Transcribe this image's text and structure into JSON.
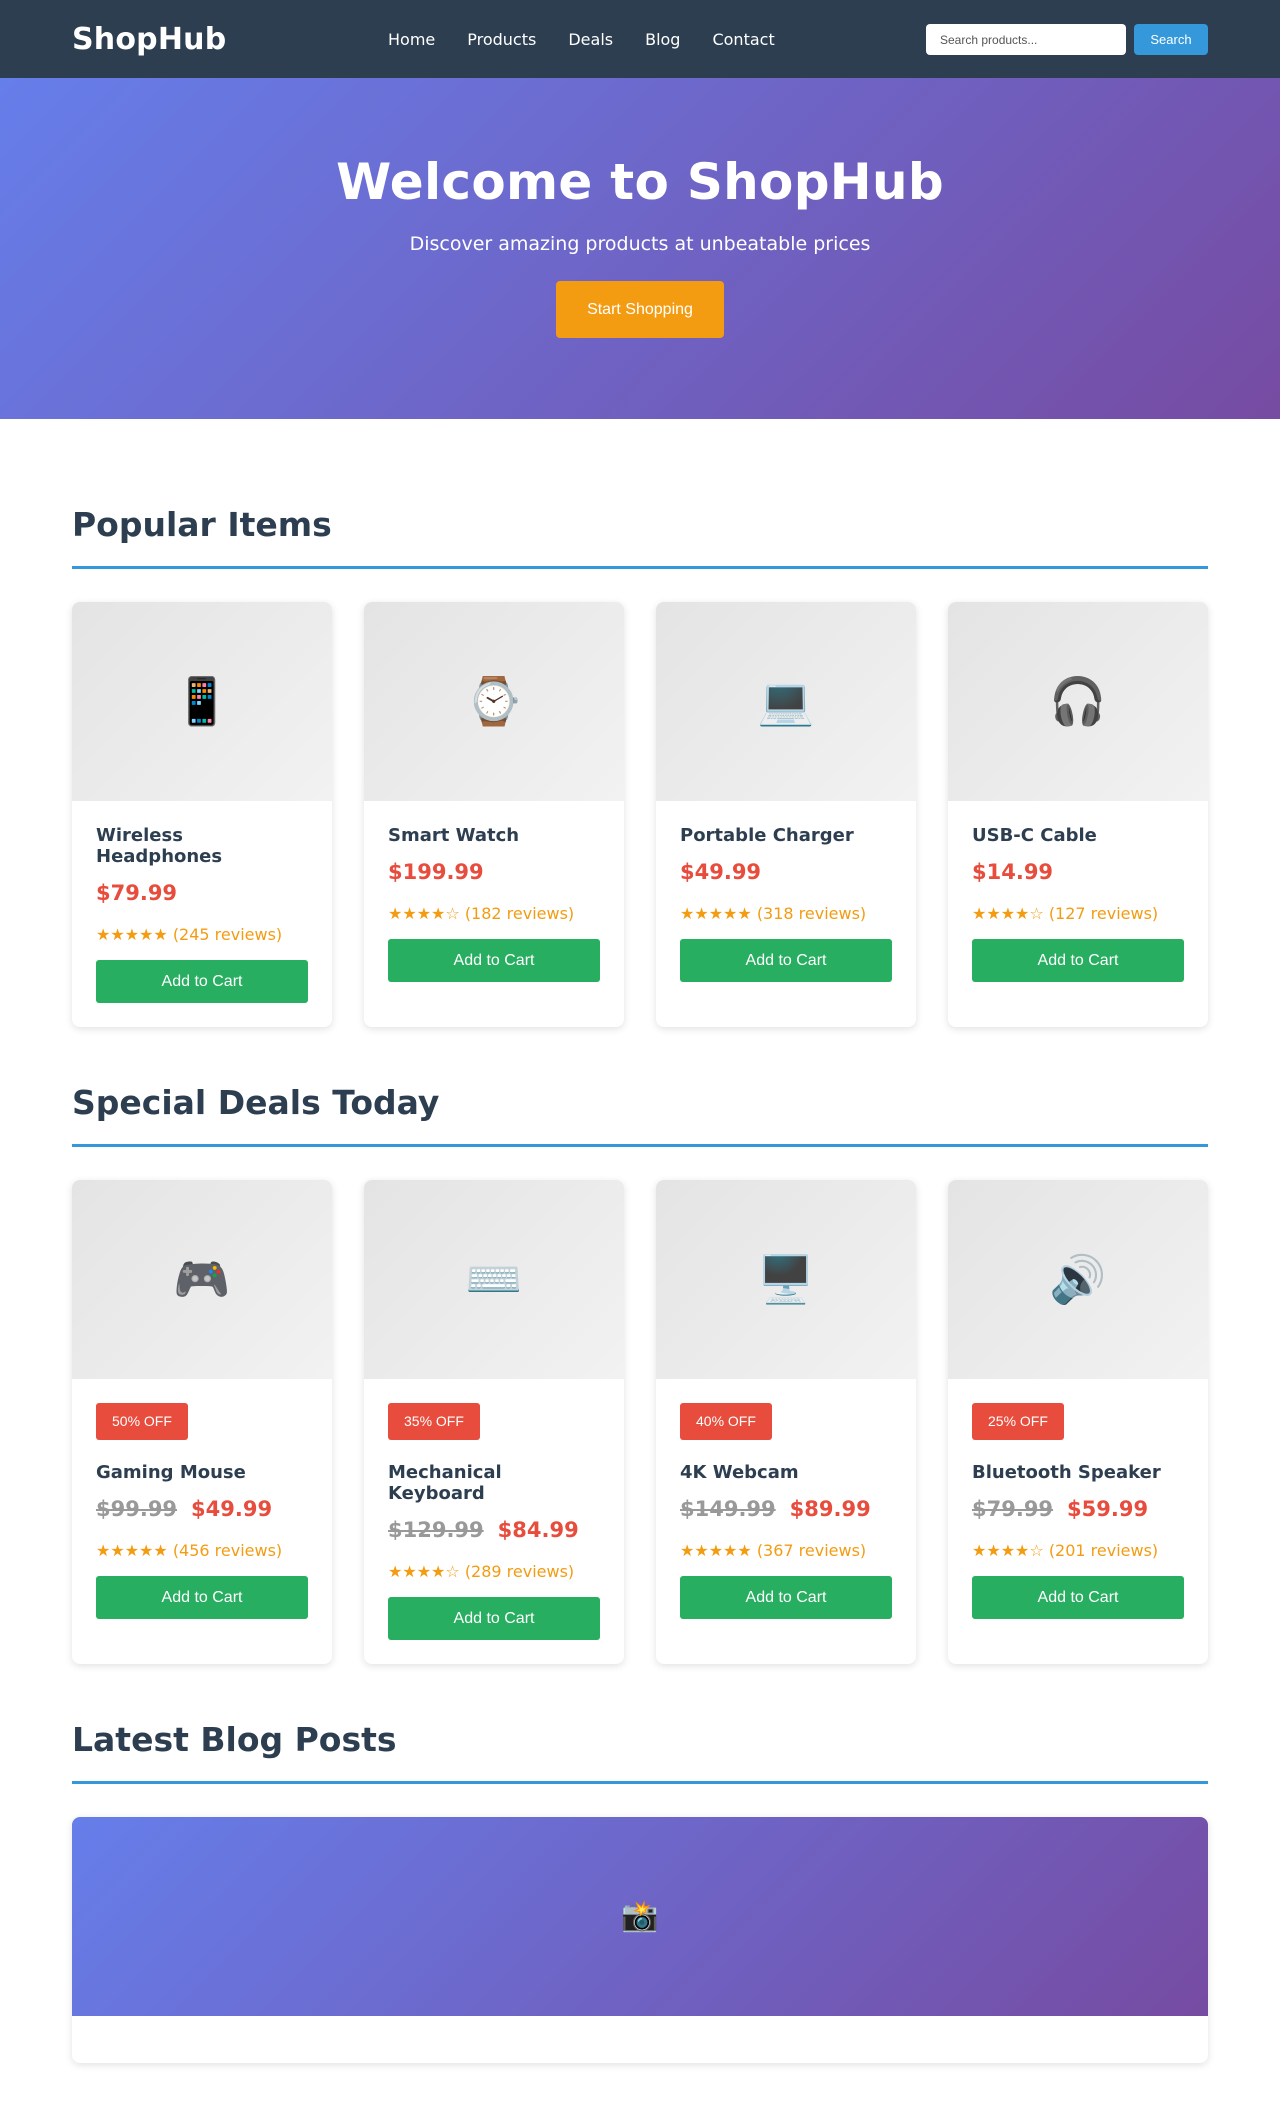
{
  "header": {
    "logo": "ShopHub",
    "nav": [
      "Home",
      "Products",
      "Deals",
      "Blog",
      "Contact"
    ],
    "search_placeholder": "Search products...",
    "search_button": "Search"
  },
  "hero": {
    "title": "Welcome to ShopHub",
    "subtitle": "Discover amazing products at unbeatable prices",
    "cta": "Start Shopping"
  },
  "popular": {
    "title": "Popular Items",
    "items": [
      {
        "icon": "📱",
        "icon_name": "mobile-phone-icon",
        "name": "Wireless Headphones",
        "price": "$79.99",
        "stars": "★★★★★",
        "reviews": "(245 reviews)",
        "button": "Add to Cart"
      },
      {
        "icon": "⌚",
        "icon_name": "watch-icon",
        "name": "Smart Watch",
        "price": "$199.99",
        "stars": "★★★★☆",
        "reviews": "(182 reviews)",
        "button": "Add to Cart"
      },
      {
        "icon": "💻",
        "icon_name": "laptop-icon",
        "name": "Portable Charger",
        "price": "$49.99",
        "stars": "★★★★★",
        "reviews": "(318 reviews)",
        "button": "Add to Cart"
      },
      {
        "icon": "🎧",
        "icon_name": "headphones-icon",
        "name": "USB-C Cable",
        "price": "$14.99",
        "stars": "★★★★☆",
        "reviews": "(127 reviews)",
        "button": "Add to Cart"
      }
    ]
  },
  "deals": {
    "title": "Special Deals Today",
    "items": [
      {
        "icon": "🎮",
        "icon_name": "game-controller-icon",
        "badge": "50% OFF",
        "name": "Gaming Mouse",
        "old_price": "$99.99",
        "price": "$49.99",
        "stars": "★★★★★",
        "reviews": "(456 reviews)",
        "button": "Add to Cart"
      },
      {
        "icon": "⌨️",
        "icon_name": "keyboard-icon",
        "badge": "35% OFF",
        "name": "Mechanical Keyboard",
        "old_price": "$129.99",
        "price": "$84.99",
        "stars": "★★★★☆",
        "reviews": "(289 reviews)",
        "button": "Add to Cart"
      },
      {
        "icon": "🖥️",
        "icon_name": "monitor-icon",
        "badge": "40% OFF",
        "name": "4K Webcam",
        "old_price": "$149.99",
        "price": "$89.99",
        "stars": "★★★★★",
        "reviews": "(367 reviews)",
        "button": "Add to Cart"
      },
      {
        "icon": "🔊",
        "icon_name": "speaker-icon",
        "badge": "25% OFF",
        "name": "Bluetooth Speaker",
        "old_price": "$79.99",
        "price": "$59.99",
        "stars": "★★★★☆",
        "reviews": "(201 reviews)",
        "button": "Add to Cart"
      }
    ]
  },
  "blog": {
    "title": "Latest Blog Posts",
    "icon": "📸",
    "icon_name": "camera-flash-icon"
  },
  "colors": {
    "header_bg": "#2c3e50",
    "accent": "#3498db",
    "cta": "#f39c12",
    "price": "#e74c3c",
    "cart_button": "#27ae60",
    "hero_gradient_start": "#667eea",
    "hero_gradient_end": "#764ba2"
  }
}
